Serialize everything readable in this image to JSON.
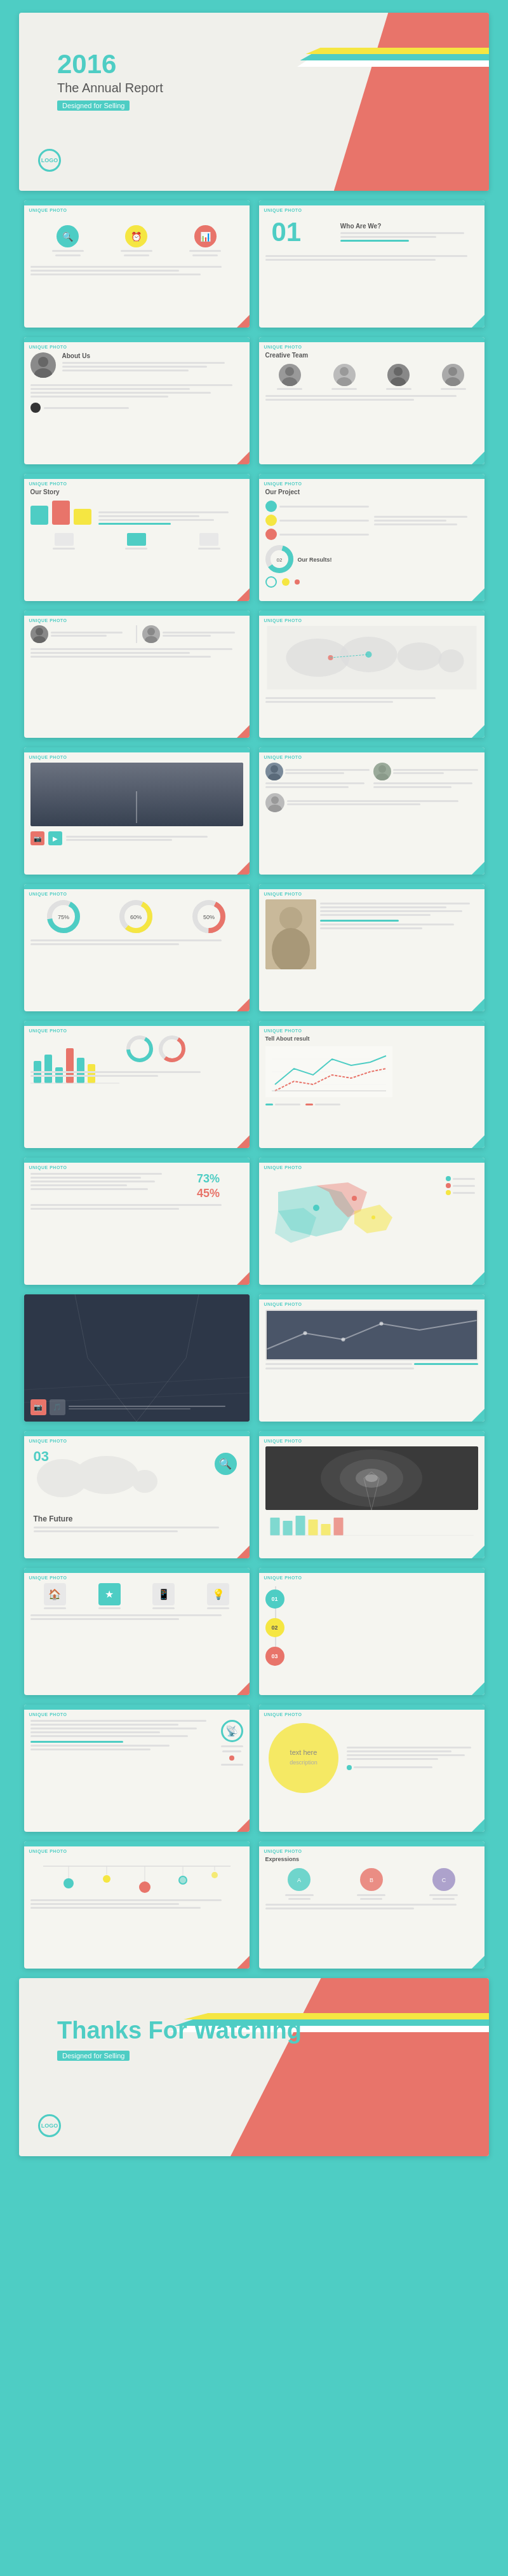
{
  "cover": {
    "year": "2016",
    "title": "The Annual Report",
    "subtitle": "Designed for Selling",
    "circle_label": "LOGO"
  },
  "thanks": {
    "title": "Thanks For Watching",
    "subtitle": "Designed for Selling"
  },
  "slides": [
    {
      "label": "Unique Photo",
      "title": ""
    },
    {
      "label": "Unique Photo",
      "title": "Who Are We?"
    },
    {
      "label": "Unique Photo",
      "title": "About Us"
    },
    {
      "label": "Unique Photo",
      "title": "Creative Team"
    },
    {
      "label": "Unique Photo",
      "title": "Our Story"
    },
    {
      "label": "Unique Photo",
      "title": "Our Project"
    },
    {
      "label": "Unique Photo",
      "title": ""
    },
    {
      "label": "Unique Photo",
      "title": "Our Results!"
    },
    {
      "label": "Unique Photo",
      "title": ""
    },
    {
      "label": "Unique Photo",
      "title": ""
    },
    {
      "label": "Unique Photo",
      "title": ""
    },
    {
      "label": "Unique Photo",
      "title": ""
    },
    {
      "label": "Unique Photo",
      "title": ""
    },
    {
      "label": "Unique Photo",
      "title": "Tell About result"
    },
    {
      "label": "Unique Photo",
      "title": ""
    },
    {
      "label": "Unique Photo",
      "title": ""
    },
    {
      "label": "Unique Photo",
      "title": "The Future"
    },
    {
      "label": "Unique Photo",
      "title": ""
    },
    {
      "label": "Unique Photo",
      "title": ""
    },
    {
      "label": "Unique Photo",
      "title": ""
    },
    {
      "label": "Unique Photo",
      "title": ""
    },
    {
      "label": "Unique Photo",
      "title": "Expressions"
    },
    {
      "label": "Unique Photo",
      "title": ""
    }
  ],
  "colors": {
    "teal": "#4ECDC4",
    "coral": "#E8746A",
    "yellow": "#F5E642",
    "white": "#ffffff",
    "light_bg": "#f5f5f0",
    "text_dark": "#555555",
    "text_light": "#888888"
  }
}
